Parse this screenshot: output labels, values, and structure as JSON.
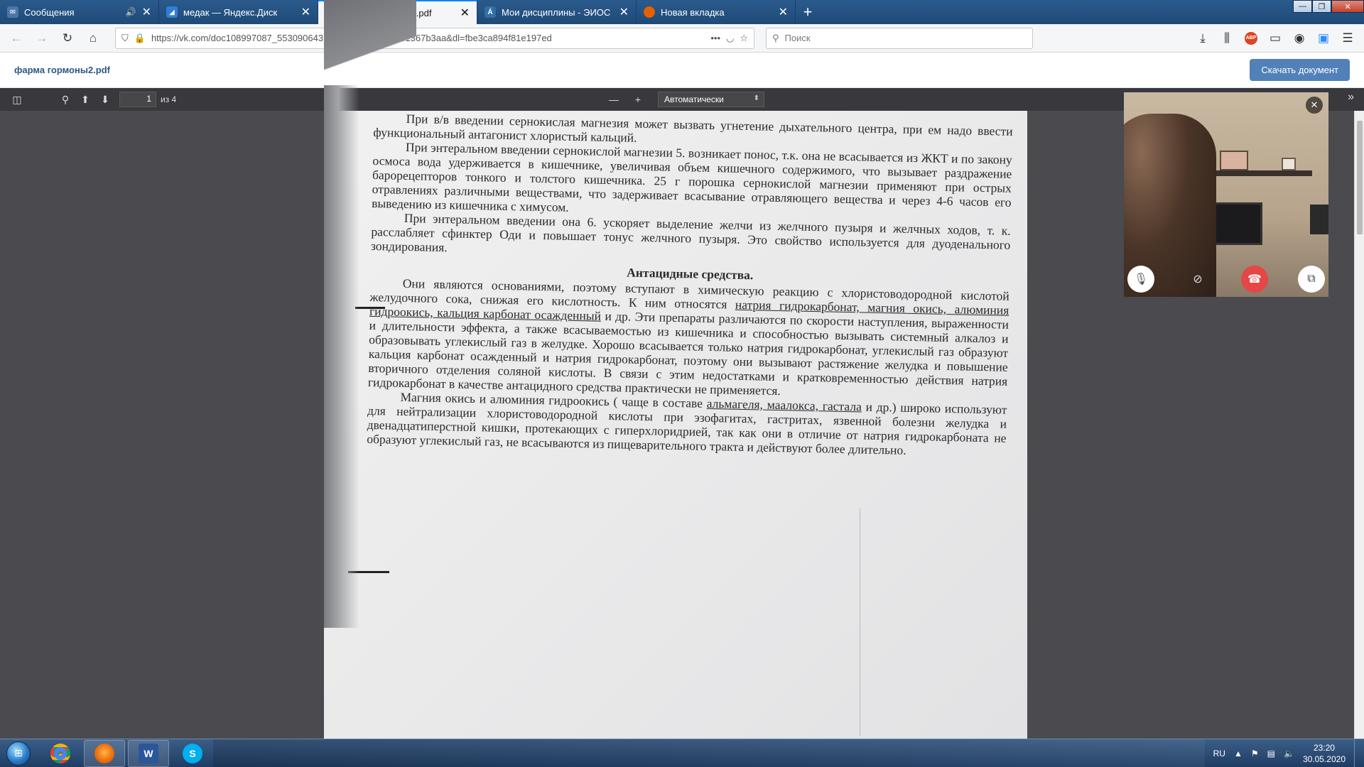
{
  "tabs": [
    {
      "title": "Сообщения",
      "icon": "vk-messages-icon",
      "color": "#4a76a8",
      "sound": true
    },
    {
      "title": "медак — Яндекс.Диск",
      "icon": "yandex-disk-icon",
      "color": "#2f7fd6",
      "sound": false
    },
    {
      "title": "фарма гормоны2.pdf",
      "icon": "vk-icon",
      "color": "#4a76a8",
      "sound": false,
      "active": true
    },
    {
      "title": "Мои дисциплины - ЭИОС",
      "icon": "eios-icon",
      "color": "#2f6fa6",
      "sound": false
    },
    {
      "title": "Новая вкладка",
      "icon": "firefox-icon",
      "color": "#e66000",
      "sound": false
    }
  ],
  "navbar": {
    "url": "https://vk.com/doc108997087_553090643?hash=722282a7751367b3aa&dl=fbe3ca894f81e197ed",
    "search_placeholder": "Поиск",
    "abp_label": "ABP"
  },
  "vk": {
    "doc_name": "фарма гормоны2.pdf",
    "download_label": "Скачать документ"
  },
  "pdf": {
    "page_current": "1",
    "page_of": "из 4",
    "zoom": "Автоматически"
  },
  "document": {
    "p1": "При в/в введении сернокислая магнезия может вызвать угнетение дыхательного центра, при ем надо ввести функциональный антагонист хлористый кальций.",
    "p2": "При энтеральном введении сернокислой магнезии 5. возникает понос, т.к. она не всасывается из ЖКТ и по закону осмоса вода удерживается в кишечнике, увеличивая объем кишечного содержимого, что вызывает раздражение барорецепторов тонкого и толстого кишечника. 25 г порошка сернокислой магнезии применяют при острых отравлениях различными веществами, что задерживает всасывание отравляющего вещества и через 4-6 часов его выведению из кишечника с химусом.",
    "p3": "При энтеральном введении она 6. ускоряет выделение желчи из желчного пузыря и желчных ходов, т. к. расслабляет сфинктер Оди и повышает тонус желчного пузыря. Это свойство используется для дуоденального зондирования.",
    "heading": "Антацидные средства.",
    "p4_a": "Они являются основаниями, поэтому вступают в химическую реакцию с хлористоводородной кислотой желудочного сока, снижая его кислотность. К ним относятся ",
    "p4_u": "натрия гидрокарбонат, магния окись, алюминия гидроокись, кальция карбонат осажденный",
    "p4_b": " и др. Эти препараты различаются по скорости наступления, выраженности и длительности эффекта, а также всасываемостью из кишечника и способностью вызывать системный алкалоз и образовывать углекислый газ в желудке. Хорошо всасывается только натрия гидрокарбонат, углекислый газ образуют кальция карбонат осажденный и натрия гидрокарбонат, поэтому они вызывают растяжение желудка и повышение вторичного отделения соляной кислоты. В связи с этим недостатками и кратковременностью действия натрия гидрокарбонат в качестве антацидного средства практически не применяется.",
    "p5_a": "Магния окись и алюминия гидроокись ( чаще в составе ",
    "p5_u": "альмагеля, маалокса, гастала",
    "p5_b": " и др.) широко используют для нейтрализации хлористоводородной кислоты при эзофагитах, гастритах, язвенной болезни желудка и двенадцатиперстной кишки, протекающих с гиперхлоридрией, так как они в отличие от натрия гидрокарбоната не образуют углекислый газ, не всасываются из пищеварительного тракта и действуют более длительно."
  },
  "taskbar": {
    "items": [
      {
        "name": "chrome",
        "color": "#db4437",
        "label": ""
      },
      {
        "name": "firefox",
        "color": "#e66000",
        "label": ""
      },
      {
        "name": "word",
        "color": "#2b579a",
        "label": "W"
      },
      {
        "name": "skype",
        "color": "#00aff0",
        "label": "S"
      }
    ],
    "lang": "RU",
    "time": "23:20",
    "date": "30.05.2020"
  }
}
